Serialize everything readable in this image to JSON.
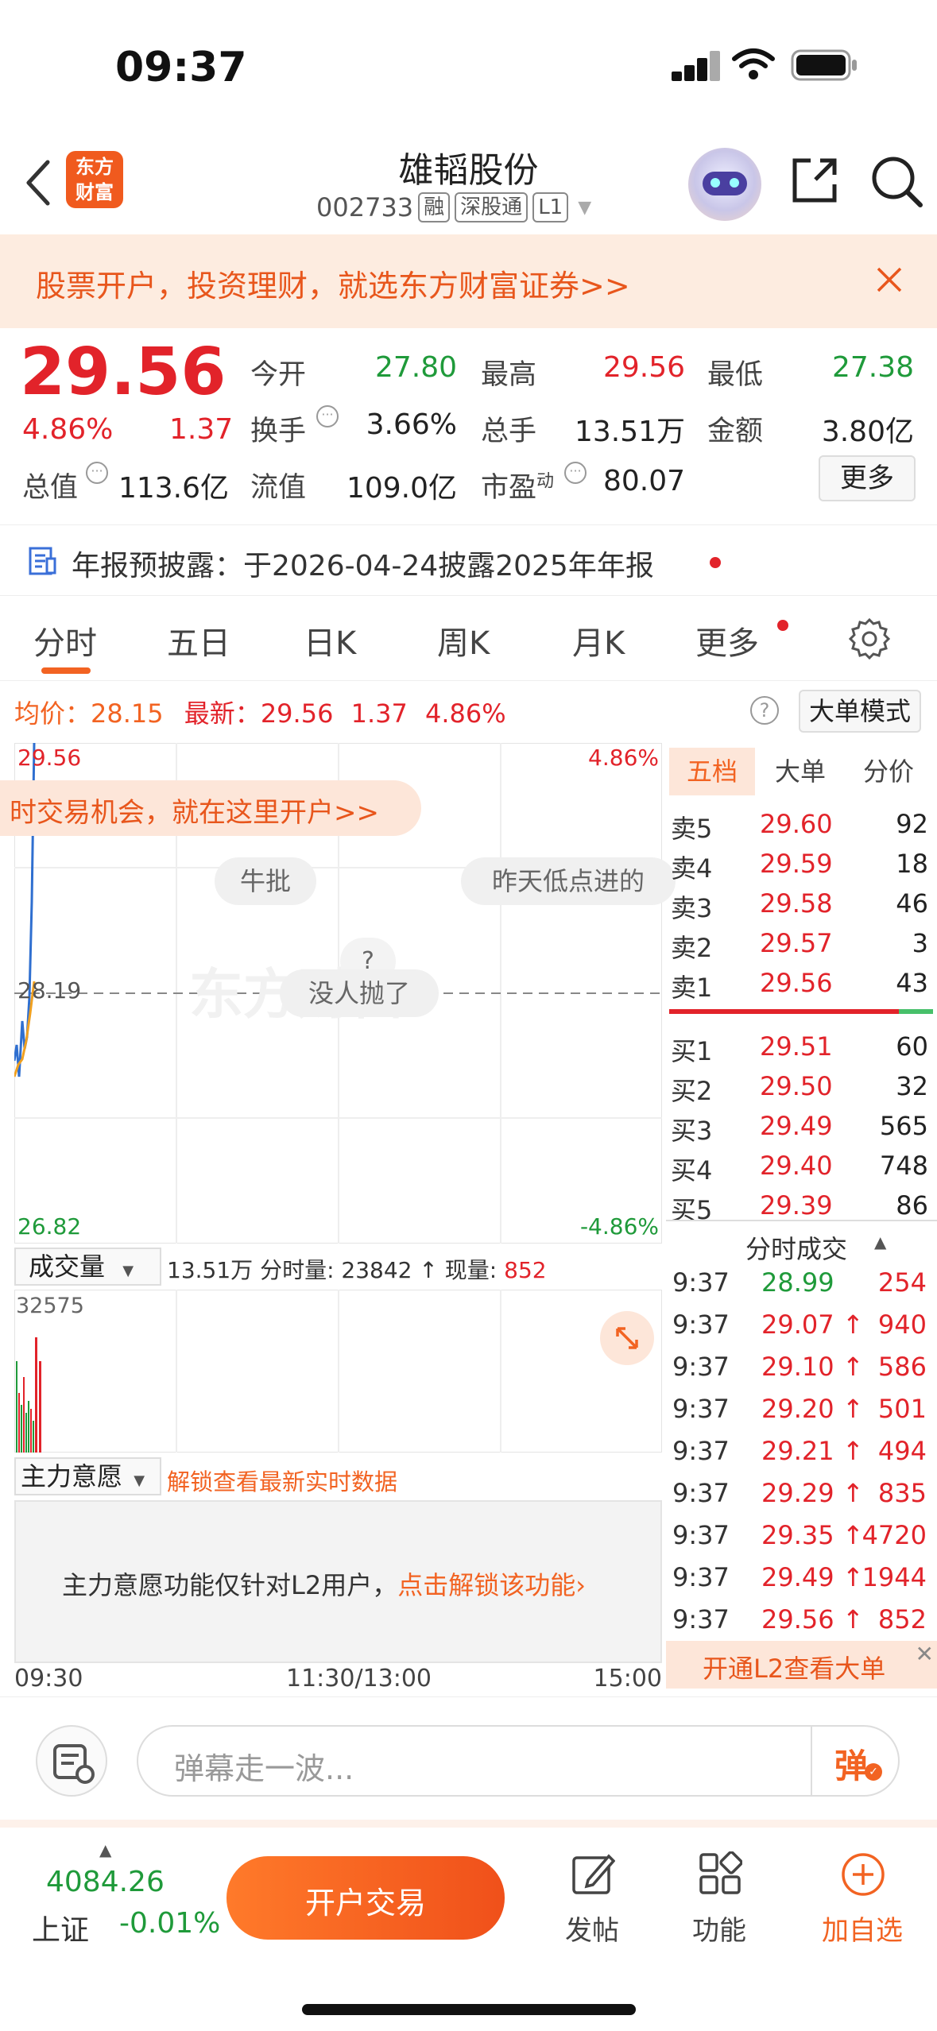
{
  "status_bar": {
    "time": "09:37"
  },
  "header": {
    "title": "雄韬股份",
    "code": "002733",
    "tags": [
      "融",
      "深股通",
      "L1"
    ],
    "logo_line1": "东方",
    "logo_line2": "财富"
  },
  "banner": {
    "text": "股票开户，投资理财，就选东方财富证券>>"
  },
  "quote": {
    "price": "29.56",
    "change_pct": "4.86%",
    "change": "1.37",
    "open_label": "今开",
    "open": "27.80",
    "high_label": "最高",
    "high": "29.56",
    "low_label": "最低",
    "low": "27.38",
    "turnover_label": "换手",
    "turnover": "3.66%",
    "volume_label": "总手",
    "volume": "13.51万",
    "amount_label": "金额",
    "amount": "3.80亿",
    "mktcap_label": "总值",
    "mktcap": "113.6亿",
    "float_label": "流值",
    "float": "109.0亿",
    "pe_label": "市盈",
    "pe_sup": "动",
    "pe": "80.07",
    "more_label": "更多"
  },
  "notice": {
    "text": "年报预披露：于2026-04-24披露2025年年报"
  },
  "tabs": [
    "分时",
    "五日",
    "日K",
    "周K",
    "月K",
    "更多"
  ],
  "chart_info": {
    "avg_label": "均价：",
    "avg": "28.15",
    "latest_label": "最新：",
    "latest": "29.56",
    "change": "1.37",
    "change_pct": "4.86%",
    "mode_label": "大单模式"
  },
  "chart_labels": {
    "top_price": "29.56",
    "top_pct": "4.86%",
    "mid_price": "28.19",
    "bottom_price": "26.82",
    "bottom_pct": "-4.86%",
    "promo": "时交易机会，就在这里开户>>",
    "danmu": [
      "牛批",
      "昨天低点进的",
      "?",
      "没人抛了"
    ],
    "watermark": "东方财富"
  },
  "volume_bar": {
    "selector": "成交量",
    "total": "13.51万",
    "period_label": "分时量:",
    "period_value": "23842",
    "current_label": "现量:",
    "current_value": "852",
    "max_label": "32575"
  },
  "main_force": {
    "selector": "主力意愿",
    "unlock": "解锁查看最新实时数据",
    "info": "主力意愿功能仅针对L2用户，",
    "link": "点击解锁该功能"
  },
  "time_axis": [
    "09:30",
    "11:30/13:00",
    "15:00"
  ],
  "orderbook": {
    "tabs": [
      "五档",
      "大单",
      "分价"
    ],
    "asks": [
      {
        "label": "卖5",
        "price": "29.60",
        "vol": "92"
      },
      {
        "label": "卖4",
        "price": "29.59",
        "vol": "18"
      },
      {
        "label": "卖3",
        "price": "29.58",
        "vol": "46"
      },
      {
        "label": "卖2",
        "price": "29.57",
        "vol": "3"
      },
      {
        "label": "卖1",
        "price": "29.56",
        "vol": "43"
      }
    ],
    "bids": [
      {
        "label": "买1",
        "price": "29.51",
        "vol": "60"
      },
      {
        "label": "买2",
        "price": "29.50",
        "vol": "32"
      },
      {
        "label": "买3",
        "price": "29.49",
        "vol": "565"
      },
      {
        "label": "买4",
        "price": "29.40",
        "vol": "748"
      },
      {
        "label": "买5",
        "price": "29.39",
        "vol": "86"
      }
    ],
    "trades_title": "分时成交",
    "trades": [
      {
        "time": "9:37",
        "price": "28.99",
        "arrow": "",
        "vol": "254"
      },
      {
        "time": "9:37",
        "price": "29.07",
        "arrow": "↑",
        "vol": "940"
      },
      {
        "time": "9:37",
        "price": "29.10",
        "arrow": "↑",
        "vol": "586"
      },
      {
        "time": "9:37",
        "price": "29.20",
        "arrow": "↑",
        "vol": "501"
      },
      {
        "time": "9:37",
        "price": "29.21",
        "arrow": "↑",
        "vol": "494"
      },
      {
        "time": "9:37",
        "price": "29.29",
        "arrow": "↑",
        "vol": "835"
      },
      {
        "time": "9:37",
        "price": "29.35",
        "arrow": "↑",
        "vol": "4720"
      },
      {
        "time": "9:37",
        "price": "29.49",
        "arrow": "↑",
        "vol": "1944"
      },
      {
        "time": "9:37",
        "price": "29.56",
        "arrow": "↑",
        "vol": "852"
      }
    ],
    "l2_promo": "开通L2查看大单"
  },
  "danmu_input": {
    "placeholder": "弹幕走一波...",
    "button": "弹"
  },
  "bottom_bar": {
    "index_value": "4084.26",
    "index_name": "上证",
    "index_change": "-0.01%",
    "trade_button": "开户交易",
    "post_label": "发帖",
    "func_label": "功能",
    "watch_label": "加自选"
  },
  "colors": {
    "up": "#e2232a",
    "down": "#1f9a3a",
    "accent": "#f26322",
    "price_line": "#2f6fd0",
    "avg_line": "#f0a020"
  }
}
